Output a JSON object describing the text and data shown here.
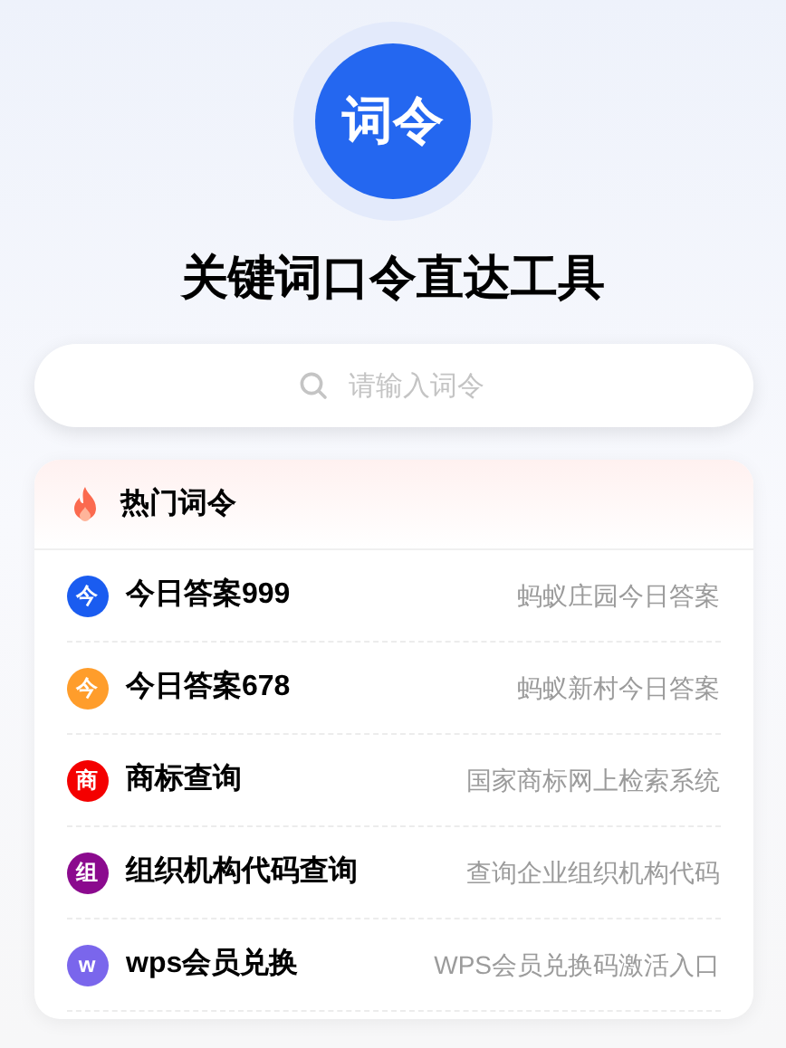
{
  "logo": {
    "text": "词令"
  },
  "title": "关键词口令直达工具",
  "search": {
    "placeholder": "请输入词令"
  },
  "hot": {
    "title": "热门词令",
    "items": [
      {
        "badge": "今",
        "color": "#1a5cf0",
        "name": "今日答案999",
        "desc": "蚂蚁庄园今日答案"
      },
      {
        "badge": "今",
        "color": "#ff9d2b",
        "name": "今日答案678",
        "desc": "蚂蚁新村今日答案"
      },
      {
        "badge": "商",
        "color": "#f40000",
        "name": "商标查询",
        "desc": "国家商标网上检索系统"
      },
      {
        "badge": "组",
        "color": "#8b0a8e",
        "name": "组织机构代码查询",
        "desc": "查询企业组织机构代码"
      },
      {
        "badge": "w",
        "color": "#7a66ec",
        "name": "wps会员兑换",
        "desc": "WPS会员兑换码激活入口"
      }
    ]
  }
}
